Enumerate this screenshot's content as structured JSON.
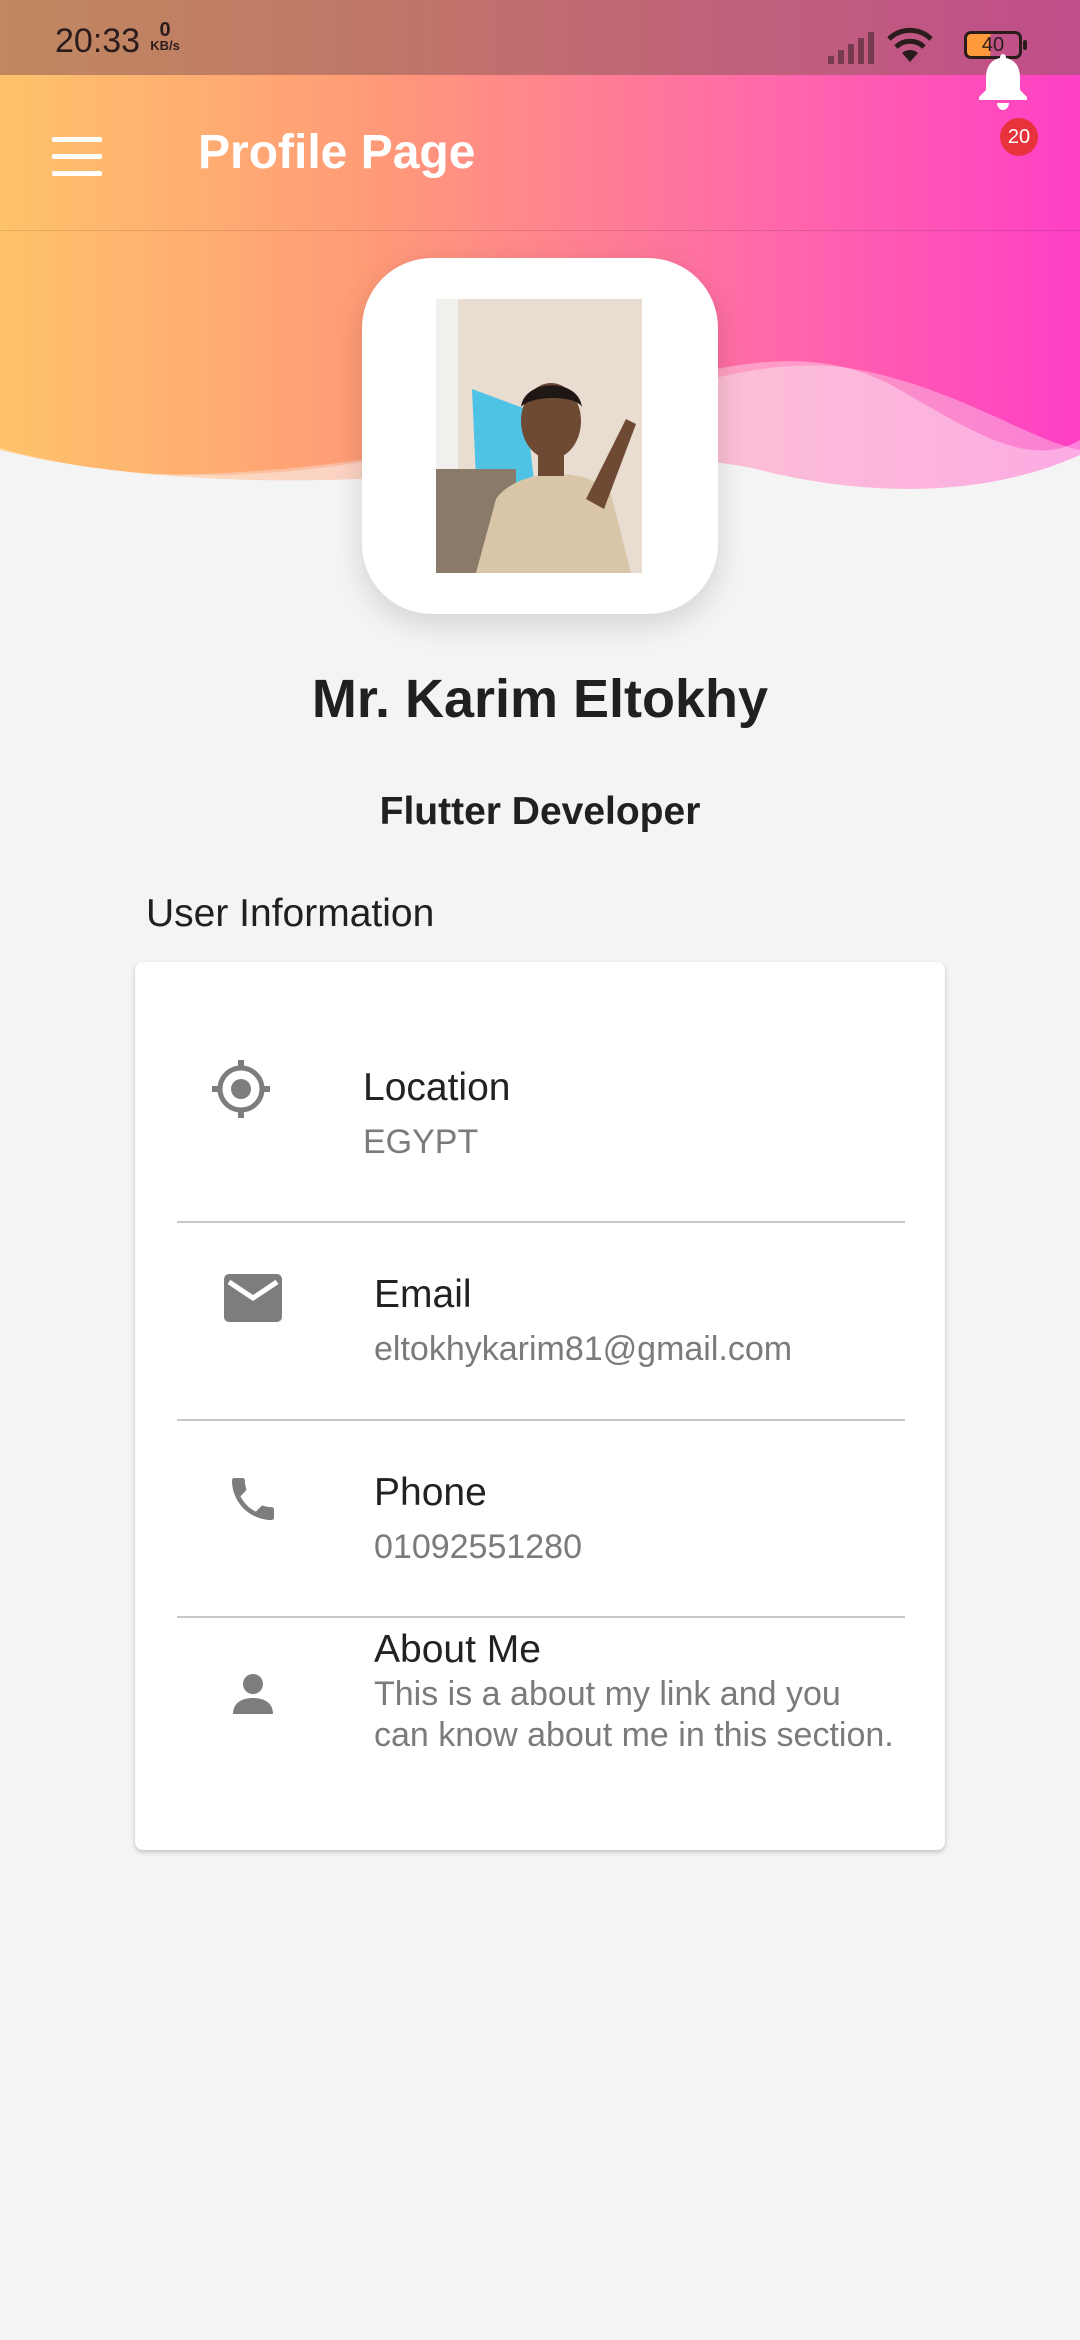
{
  "status_bar": {
    "time": "20:33",
    "net_speed": "0",
    "net_unit": "KB/s",
    "battery": "40"
  },
  "app_bar": {
    "title": "Profile Page",
    "notification_count": "20"
  },
  "profile": {
    "name": "Mr. Karim Eltokhy",
    "role": "Flutter Developer"
  },
  "user_information": {
    "heading": "User Information",
    "items": [
      {
        "icon": "location-icon",
        "label": "Location",
        "value": "EGYPT"
      },
      {
        "icon": "email-icon",
        "label": "Email",
        "value": "eltokhykarim81@gmail.com"
      },
      {
        "icon": "phone-icon",
        "label": "Phone",
        "value": "01092551280"
      },
      {
        "icon": "person-icon",
        "label": "About Me",
        "value": "This is a about my link and you can know about me in this section."
      }
    ]
  },
  "colors": {
    "gradient_start": "#ffc36a",
    "gradient_end": "#ff3fc6",
    "badge": "#e8323c",
    "icon_grey": "#7d7d7d",
    "background": "#f4f4f4"
  }
}
